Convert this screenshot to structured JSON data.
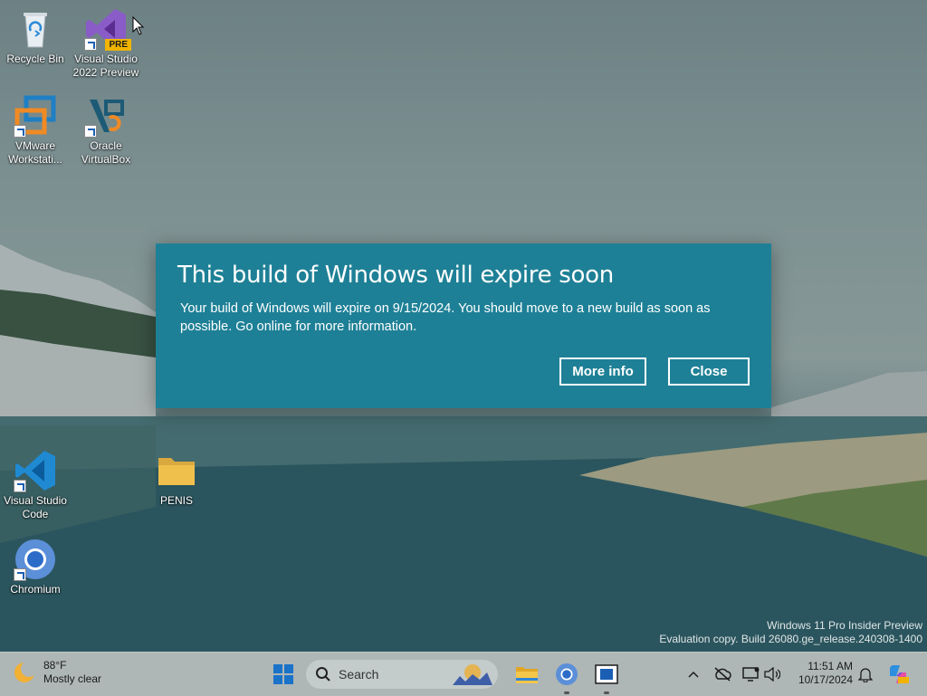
{
  "desktop": {
    "icons": [
      {
        "label": "Recycle Bin",
        "icon": "recycle-bin-icon"
      },
      {
        "label": "Visual Studio 2022 Preview",
        "icon": "visual-studio-icon",
        "badge": "PRE"
      },
      {
        "label": "VMware Workstati...",
        "icon": "vmware-icon"
      },
      {
        "label": "Oracle VirtualBox",
        "icon": "virtualbox-icon"
      },
      {
        "label": "Visual Studio Code",
        "icon": "vscode-icon"
      },
      {
        "label": "PENIS",
        "icon": "folder-icon"
      },
      {
        "label": "Chromium",
        "icon": "chromium-icon"
      }
    ]
  },
  "dialog": {
    "title": "This build of Windows will expire soon",
    "body": "Your build of Windows will expire on 9/15/2024. You should move to a new build as soon as possible. Go online for more information.",
    "more_info_label": "More info",
    "close_label": "Close",
    "background_color": "#1e8096"
  },
  "watermark": {
    "line1": "Windows 11 Pro Insider Preview",
    "line2": "Evaluation copy. Build 26080.ge_release.240308-1400"
  },
  "taskbar": {
    "weather": {
      "temp": "88°F",
      "condition": "Mostly clear"
    },
    "search_placeholder": "Search",
    "apps": [
      "start-icon",
      "file-explorer-icon",
      "chromium-icon",
      "app-window-icon"
    ],
    "tray_icons": [
      "chevron-up-icon",
      "network-off-icon",
      "display-icon",
      "volume-icon"
    ],
    "time": "11:51 AM",
    "date": "10/17/2024"
  }
}
